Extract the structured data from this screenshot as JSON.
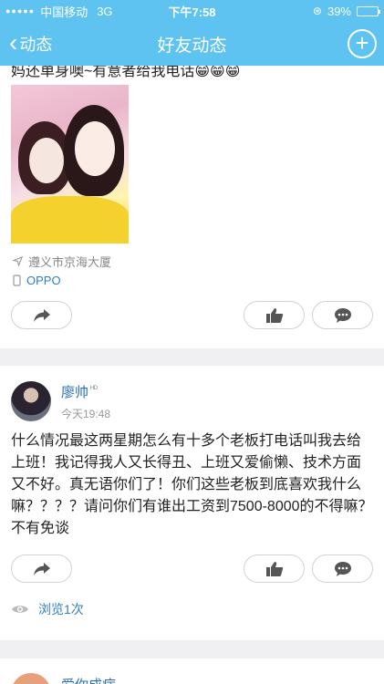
{
  "status_bar": {
    "signal": "●●●●●",
    "carrier": "中国移动",
    "network": "3G",
    "time": "下午7:58",
    "battery_text": "39%",
    "battery_level": 0.39
  },
  "nav": {
    "back_label": "动态",
    "title": "好友动态",
    "add_icon": "plus-circle-icon"
  },
  "post1": {
    "text_tail": "妈还单身噢~有意者给我电话😁😁😁",
    "location": "遵义市京海大厦",
    "device": "OPPO"
  },
  "post2": {
    "author": "廖帅",
    "author_badge": "ᴴᴰ",
    "time": "今天19:48",
    "text": "什么情况最这两星期怎么有十多个老板打电话叫我去给上班！我记得我人又长得丑、上班又爱偷懒、技术方面又不好。真无语你们了！你们这些老板到底喜欢我什么嘛？？？？请问你们有谁出工资到7500-8000的不得嘛？不有免谈",
    "views": "浏览1次"
  },
  "post3": {
    "author": "爱你成病"
  },
  "colors": {
    "header": "#5ec3f0",
    "link": "#2b6fb2",
    "background": "#f0f0f2"
  }
}
